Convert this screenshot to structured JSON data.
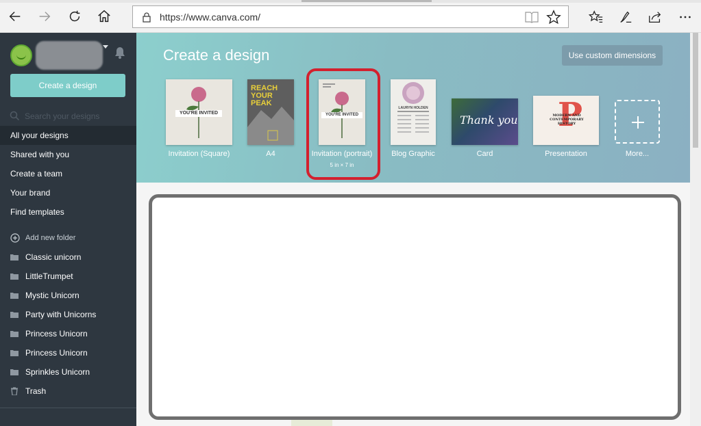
{
  "browser": {
    "url": "https://www.canva.com/",
    "icons": {
      "back": "back-arrow-icon",
      "forward": "forward-arrow-icon",
      "refresh": "refresh-icon",
      "home": "home-icon",
      "lock": "lock-icon",
      "reading_view": "reading-view-icon",
      "favorite": "star-icon",
      "favorites_hub": "favorites-hub-icon",
      "notes": "pen-icon",
      "share": "share-icon",
      "more": "ellipsis-icon"
    }
  },
  "sidebar": {
    "create_button": "Create a design",
    "search_placeholder": "Search your designs",
    "nav_items": [
      {
        "label": "All your designs",
        "active": true
      },
      {
        "label": "Shared with you"
      },
      {
        "label": "Create a team"
      },
      {
        "label": "Your brand"
      },
      {
        "label": "Find templates"
      }
    ],
    "add_folder": "Add new folder",
    "folders": [
      "Classic unicorn",
      "LittleTrumpet",
      "Mystic Unicorn",
      "Party with Unicorns",
      "Princess Unicorn",
      "Princess Unicorn",
      "Sprinkles Unicorn"
    ],
    "trash": "Trash"
  },
  "hero": {
    "title": "Create a design",
    "custom_dimensions": "Use custom dimensions",
    "templates": [
      {
        "label": "Invitation (Square)",
        "thumb_text": "YOU'RE INVITED"
      },
      {
        "label": "A4",
        "thumb_text": "REACH YOUR PEAK"
      },
      {
        "label": "Invitation (portrait)",
        "sub": "5 in × 7 in",
        "thumb_text": "YOU'RE INVITED"
      },
      {
        "label": "Blog Graphic",
        "thumb_text": "LAURYN HOLDEN"
      },
      {
        "label": "Card",
        "thumb_text": "Thank you"
      },
      {
        "label": "Presentation",
        "thumb_text": "MODERN AND CONTEMPORARY HISTORY"
      },
      {
        "label": "More..."
      }
    ]
  },
  "colors": {
    "sidebar_bg": "#2e3740",
    "accent_teal": "#7ecdc9",
    "highlight_red": "#d3202e"
  }
}
